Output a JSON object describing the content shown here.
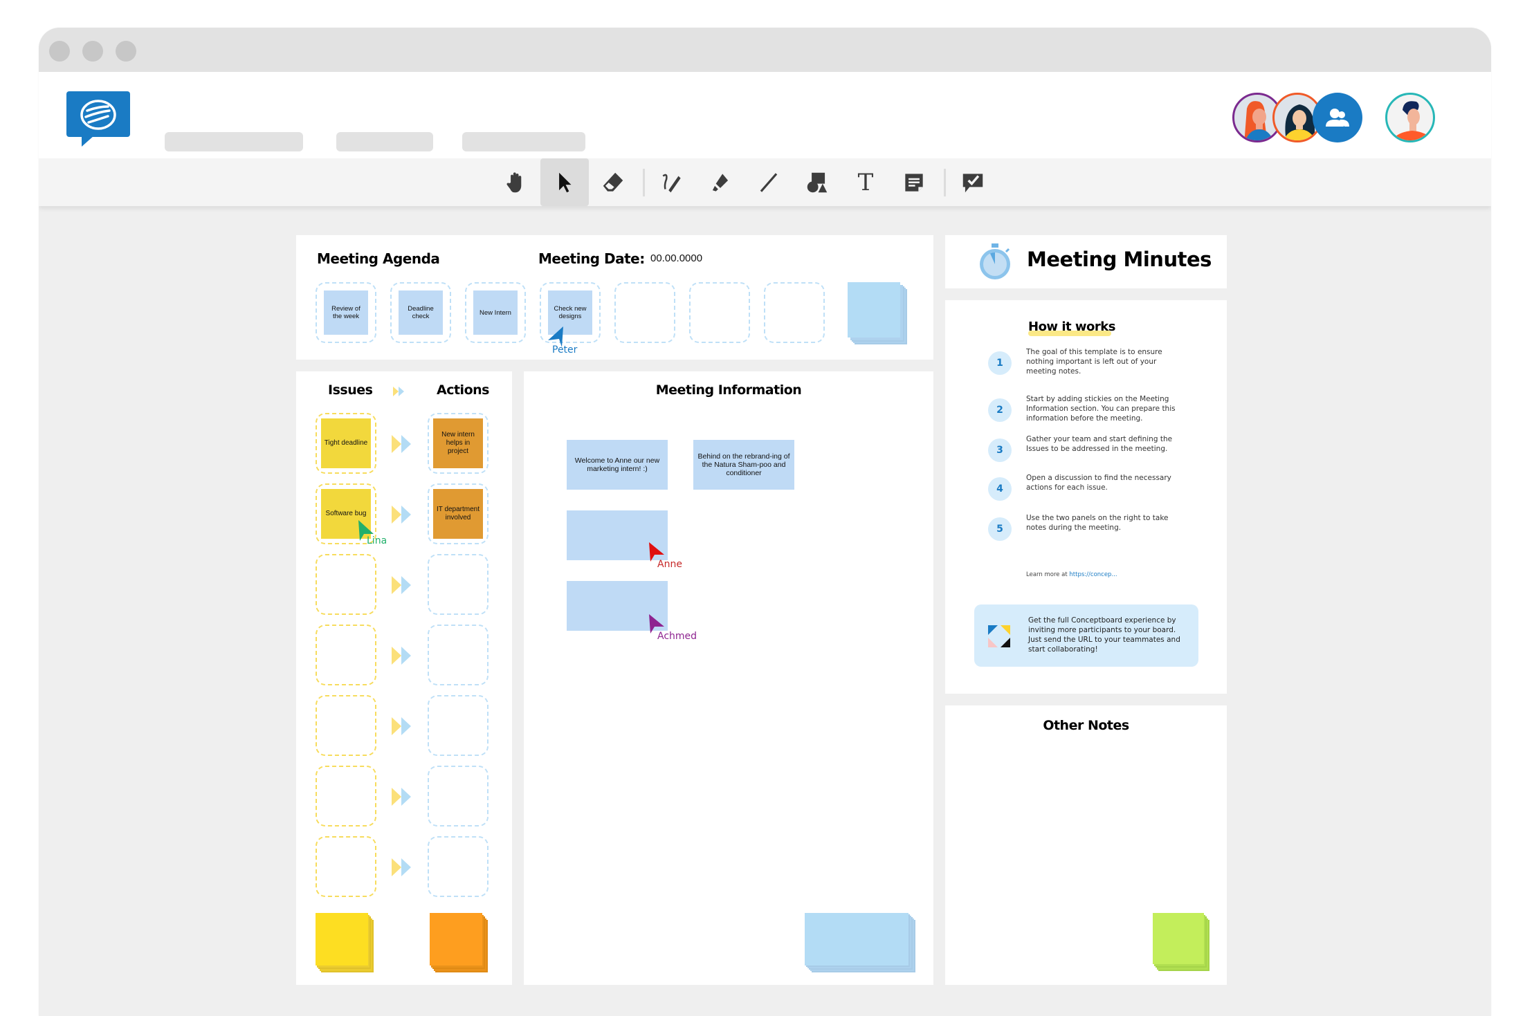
{
  "window": {
    "controls": [
      "close",
      "minimize",
      "maximize"
    ]
  },
  "header": {
    "logo": "conceptboard-logo",
    "nav_placeholders": 3,
    "participants": [
      {
        "name": "participant-1",
        "ring_color": "#7b2a8f"
      },
      {
        "name": "participant-2",
        "ring_color": "#f05a28"
      },
      {
        "name": "participants-group",
        "ring_color": "#1a7bc4"
      }
    ],
    "current_user": {
      "ring_color": "#27b7b7"
    }
  },
  "toolbar": {
    "tools": [
      {
        "id": "hand",
        "icon": "hand-icon",
        "label": "Pan"
      },
      {
        "id": "select",
        "icon": "cursor-icon",
        "label": "Select",
        "active": true
      },
      {
        "id": "eraser",
        "icon": "eraser-icon",
        "label": "Eraser"
      },
      {
        "id": "pen",
        "icon": "pen-icon",
        "label": "Pen"
      },
      {
        "id": "marker",
        "icon": "marker-icon",
        "label": "Highlighter"
      },
      {
        "id": "line",
        "icon": "line-icon",
        "label": "Line"
      },
      {
        "id": "shapes",
        "icon": "shapes-icon",
        "label": "Shapes"
      },
      {
        "id": "text",
        "icon": "text-icon",
        "label": "Text",
        "glyph": "T"
      },
      {
        "id": "sticky",
        "icon": "sticky-note-icon",
        "label": "Sticky note"
      },
      {
        "id": "review",
        "icon": "review-icon",
        "label": "Review"
      }
    ]
  },
  "agenda": {
    "title": "Meeting Agenda",
    "date_label": "Meeting Date:",
    "date_value": "00.00.0000",
    "items": [
      "Review of the week",
      "Deadline check",
      "New Intern",
      "Check new designs",
      "",
      "",
      ""
    ]
  },
  "issues_actions": {
    "issues_title": "Issues",
    "actions_title": "Actions",
    "rows": [
      {
        "issue": "Tight deadline",
        "action": "New intern helps in project"
      },
      {
        "issue": "Software bug",
        "action": "IT department involved"
      },
      {
        "issue": "",
        "action": ""
      },
      {
        "issue": "",
        "action": ""
      },
      {
        "issue": "",
        "action": ""
      },
      {
        "issue": "",
        "action": ""
      },
      {
        "issue": "",
        "action": ""
      }
    ]
  },
  "meeting_info": {
    "title": "Meeting Information",
    "notes": [
      "Welcome to Anne our new marketing intern! :)",
      "Behind on the rebrand-ing of the Natura Sham-poo and conditioner",
      "",
      ""
    ]
  },
  "minutes": {
    "title": "Meeting Minutes",
    "how_title": "How it works",
    "steps": [
      {
        "num": "1",
        "text": "The goal of this template is to ensure nothing important is left out of your meeting notes."
      },
      {
        "num": "2",
        "text": "Start by adding stickies on the Meeting Information section. You can prepare this information before the meeting."
      },
      {
        "num": "3",
        "text": "Gather your team and start defining the Issues to be addressed in the meeting."
      },
      {
        "num": "4",
        "text": "Open a discussion to find the necessary actions for each issue."
      },
      {
        "num": "5",
        "text": "Use the two panels on the right to take notes during the meeting."
      }
    ],
    "learn_more_prefix": "Learn more at ",
    "learn_more_link": "https://concep...",
    "promo_text": "Get the full Conceptboard experience by inviting more participants to your board. Just send the URL to your teammates and start collaborating!"
  },
  "other_notes": {
    "title": "Other Notes"
  },
  "cursors": [
    {
      "name": "Peter",
      "color": "#1a7bc4"
    },
    {
      "name": "Lina",
      "color": "#22b06b"
    },
    {
      "name": "Anne",
      "color": "#d62020"
    },
    {
      "name": "Achmed",
      "color": "#8e2490"
    }
  ],
  "colors": {
    "brand": "#1a7bc4",
    "sticky_blue": "#bfdaf5",
    "sticky_yellow": "#f2d83c",
    "sticky_orange": "#e09a32",
    "sticky_green": "#c3ee5b"
  }
}
